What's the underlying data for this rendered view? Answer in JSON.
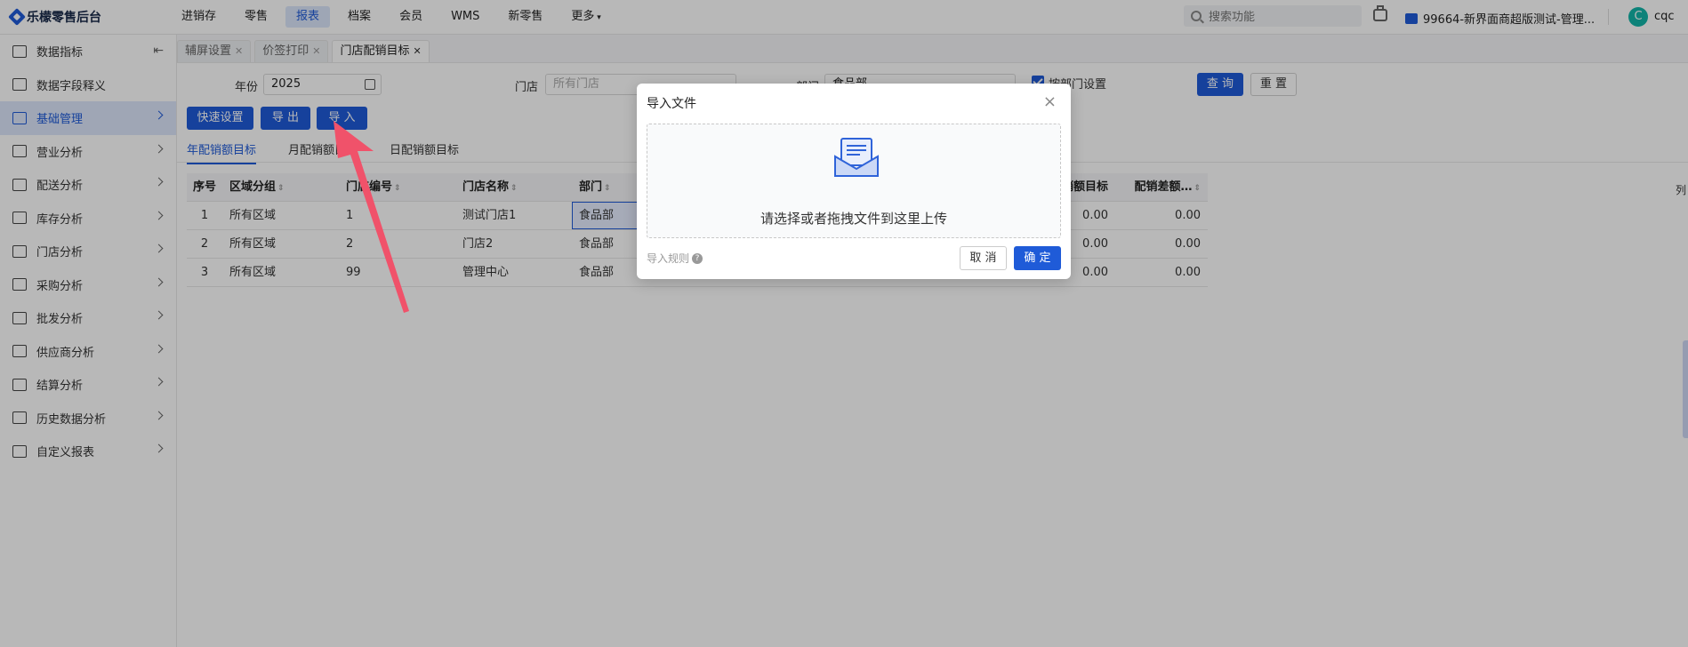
{
  "app": {
    "title": "乐檬零售后台"
  },
  "nav": {
    "items": [
      {
        "label": "进销存"
      },
      {
        "label": "零售"
      },
      {
        "label": "报表",
        "active": true
      },
      {
        "label": "档案"
      },
      {
        "label": "会员"
      },
      {
        "label": "WMS"
      },
      {
        "label": "新零售"
      },
      {
        "label": "更多"
      }
    ],
    "search_placeholder": "搜索功能",
    "store": "99664-新界面商超版测试-管理...",
    "avatar_letter": "C",
    "username": "cqc"
  },
  "sidebar": {
    "items": [
      {
        "label": "数据指标",
        "icon": "home-icon"
      },
      {
        "label": "数据字段释义",
        "icon": "monitor-icon"
      },
      {
        "label": "基础管理",
        "icon": "grid-icon",
        "active": true
      },
      {
        "label": "营业分析",
        "icon": "store-icon"
      },
      {
        "label": "配送分析",
        "icon": "truck-icon"
      },
      {
        "label": "库存分析",
        "icon": "box-icon"
      },
      {
        "label": "门店分析",
        "icon": "shop-icon"
      },
      {
        "label": "采购分析",
        "icon": "cart-icon"
      },
      {
        "label": "批发分析",
        "icon": "wholesale-icon"
      },
      {
        "label": "供应商分析",
        "icon": "user-icon"
      },
      {
        "label": "结算分析",
        "icon": "dollar-icon"
      },
      {
        "label": "历史数据分析",
        "icon": "chart-icon"
      },
      {
        "label": "自定义报表",
        "icon": "report-icon"
      }
    ]
  },
  "tabs": [
    {
      "label": "辅屏设置"
    },
    {
      "label": "价签打印"
    },
    {
      "label": "门店配销目标",
      "active": true
    }
  ],
  "filters": {
    "year_label": "年份",
    "year_value": "2025",
    "store_label": "门店",
    "store_placeholder": "所有门店",
    "dept_label": "部门",
    "dept_value": "食品部",
    "by_dept_label": "按部门设置",
    "query_label": "查 询",
    "reset_label": "重 置"
  },
  "actions": {
    "quick": "快速设置",
    "export": "导 出",
    "import": "导 入"
  },
  "subtabs": [
    {
      "label": "年配销额目标",
      "active": true
    },
    {
      "label": "月配销额目标"
    },
    {
      "label": "日配销额目标"
    }
  ],
  "table": {
    "headers": [
      "序号",
      "区域分组",
      "门店编号",
      "门店名称",
      "部门",
      "",
      "配销额目标",
      "配销差额…"
    ],
    "rows": [
      [
        "1",
        "所有区域",
        "1",
        "测试门店1",
        "食品部",
        "",
        "0.00",
        "0.00"
      ],
      [
        "2",
        "所有区域",
        "2",
        "门店2",
        "食品部",
        "",
        "0.00",
        "0.00"
      ],
      [
        "3",
        "所有区域",
        "99",
        "管理中心",
        "食品部",
        "",
        "0.00",
        "0.00"
      ]
    ],
    "col_settings": "列"
  },
  "modal": {
    "title": "导入文件",
    "drop_text": "请选择或者拖拽文件到这里上传",
    "rules": "导入规则",
    "cancel": "取 消",
    "ok": "确 定"
  }
}
